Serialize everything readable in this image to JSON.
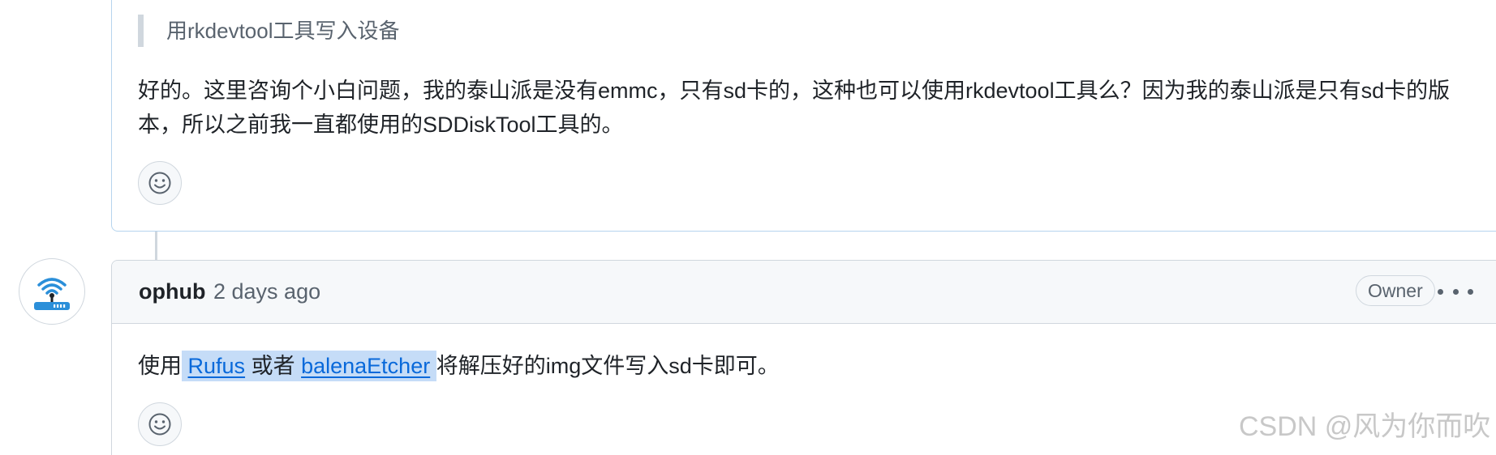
{
  "comment1": {
    "quote_text": "用rkdevtool工具写入设备",
    "paragraph": "好的。这里咨询个小白问题，我的泰山派是没有emmc，只有sd卡的，这种也可以使用rkdevtool工具么？因为我的泰山派是只有sd卡的版本，所以之前我一直都使用的SDDiskTool工具的。"
  },
  "comment2": {
    "author": "ophub",
    "timestamp": "2 days ago",
    "badge": "Owner",
    "body": {
      "prefix": "使用",
      "link1": "Rufus",
      "middle": "或者",
      "link2": "balenaEtcher",
      "suffix": "将解压好的img文件写入sd卡即可。"
    }
  },
  "watermark": "CSDN @风为你而吹",
  "colors": {
    "link": "#0969da",
    "border": "#d0d7de",
    "highlight_border": "#b6d4ee",
    "selection": "#c5dcf7"
  },
  "icons": {
    "reaction": "smiley-icon",
    "avatar": "wifi-router-icon",
    "more": "kebab-horizontal-icon"
  }
}
